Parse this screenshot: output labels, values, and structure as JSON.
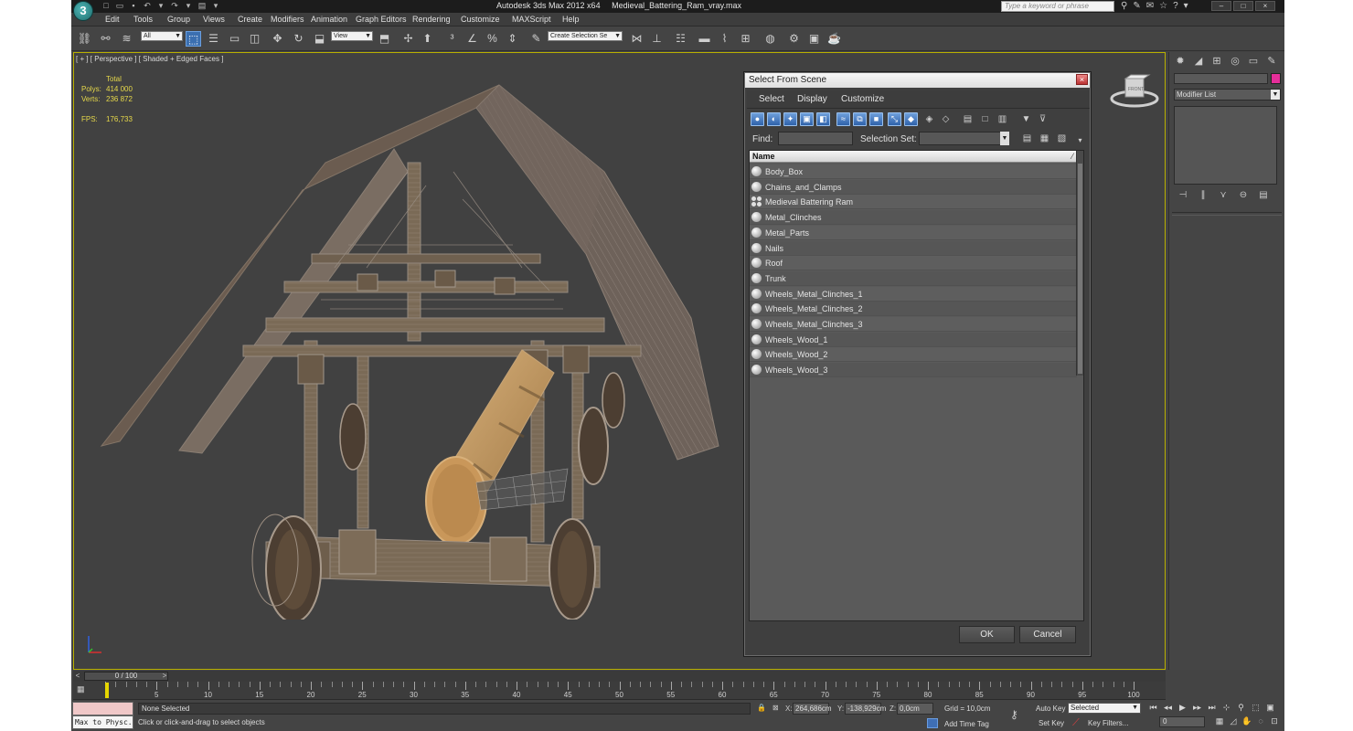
{
  "app": {
    "logo_glyph": "3",
    "title": "Autodesk 3ds Max  2012 x64",
    "file": "Medieval_Battering_Ram_vray.max",
    "search_placeholder": "Type a keyword or phrase"
  },
  "menu": [
    "Edit",
    "Tools",
    "Group",
    "Views",
    "Create",
    "Modifiers",
    "Animation",
    "Graph Editors",
    "Rendering",
    "Customize",
    "MAXScript",
    "Help"
  ],
  "toolbar": {
    "filter_value": "All",
    "ref_coord": "View",
    "selection_set_placeholder": "Create Selection Se"
  },
  "viewport": {
    "label": "[ + ] [ Perspective ] [ Shaded + Edged Faces ]",
    "stats": {
      "header": "Total",
      "polys_label": "Polys:",
      "polys": "414 000",
      "verts_label": "Verts:",
      "verts": "236 872",
      "fps_label": "FPS:",
      "fps": "176,733"
    },
    "viewcube_label": "FRONT"
  },
  "dialog": {
    "title": "Select From Scene",
    "close_glyph": "×",
    "menu": [
      "Select",
      "Display",
      "Customize"
    ],
    "find_label": "Find:",
    "selection_set_label": "Selection Set:",
    "column_header": "Name",
    "objects": [
      {
        "name": "Body_Box",
        "type": "object"
      },
      {
        "name": "Chains_and_Clamps",
        "type": "object"
      },
      {
        "name": "Medieval Battering Ram",
        "type": "group"
      },
      {
        "name": "Metal_Clinches",
        "type": "object"
      },
      {
        "name": "Metal_Parts",
        "type": "object"
      },
      {
        "name": "Nails",
        "type": "object"
      },
      {
        "name": "Roof",
        "type": "object"
      },
      {
        "name": "Trunk",
        "type": "object"
      },
      {
        "name": "Wheels_Metal_Clinches_1",
        "type": "object"
      },
      {
        "name": "Wheels_Metal_Clinches_2",
        "type": "object"
      },
      {
        "name": "Wheels_Metal_Clinches_3",
        "type": "object"
      },
      {
        "name": "Wheels_Wood_1",
        "type": "object"
      },
      {
        "name": "Wheels_Wood_2",
        "type": "object"
      },
      {
        "name": "Wheels_Wood_3",
        "type": "object"
      }
    ],
    "ok_label": "OK",
    "cancel_label": "Cancel"
  },
  "command_panel": {
    "modifier_list": "Modifier List",
    "object_color": "#e62e9a"
  },
  "timeline": {
    "position": "0 / 100",
    "ticks": [
      0,
      5,
      10,
      15,
      20,
      25,
      30,
      35,
      40,
      45,
      50,
      55,
      60,
      65,
      70,
      75,
      80,
      85,
      90,
      95,
      100
    ]
  },
  "status": {
    "listener": "Max to Physc.",
    "selection": "None Selected",
    "prompt": "Click or click-and-drag to select objects",
    "x_label": "X:",
    "x": "264,686cm",
    "y_label": "Y:",
    "y": "-138,929cm",
    "z_label": "Z:",
    "z": "0,0cm",
    "grid": "Grid = 10,0cm",
    "auto_key": "Auto Key",
    "set_key": "Set Key",
    "key_mode": "Selected",
    "key_filters": "Key Filters...",
    "add_time_tag": "Add Time Tag",
    "frame": "0"
  },
  "colors": {
    "viewport_border": "#b9b000",
    "stats_text": "#e6d84a",
    "time_cursor": "#e6d600"
  }
}
